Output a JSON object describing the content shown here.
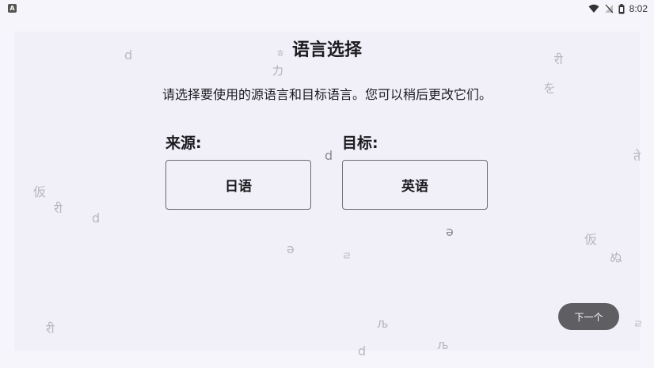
{
  "status_bar": {
    "app_icon": "A",
    "icons": [
      "wifi-icon",
      "signal-icon",
      "battery-icon"
    ],
    "time": "8:02"
  },
  "page": {
    "title": "语言选择",
    "subtitle": "请选择要使用的源语言和目标语言。您可以稍后更改它们。"
  },
  "source": {
    "label": "来源:",
    "value": "日语"
  },
  "target": {
    "label": "目标:",
    "value": "英语"
  },
  "next_button": {
    "label": "下一个"
  },
  "decorations": [
    "d",
    "ㅎ",
    "カ",
    "री",
    "を",
    "d",
    "ते",
    "仮",
    "री",
    "d",
    "ə",
    "ə",
    "ㄹ",
    "仮",
    "ぬ",
    "री",
    "љ",
    "љ",
    "d",
    "ㄹ"
  ],
  "colors": {
    "background": "#f6f5fb",
    "panel": "#f1f0f8",
    "button_border": "#6b6b70",
    "next_button": "#5f5f63",
    "decoration": "#b8b8be"
  }
}
